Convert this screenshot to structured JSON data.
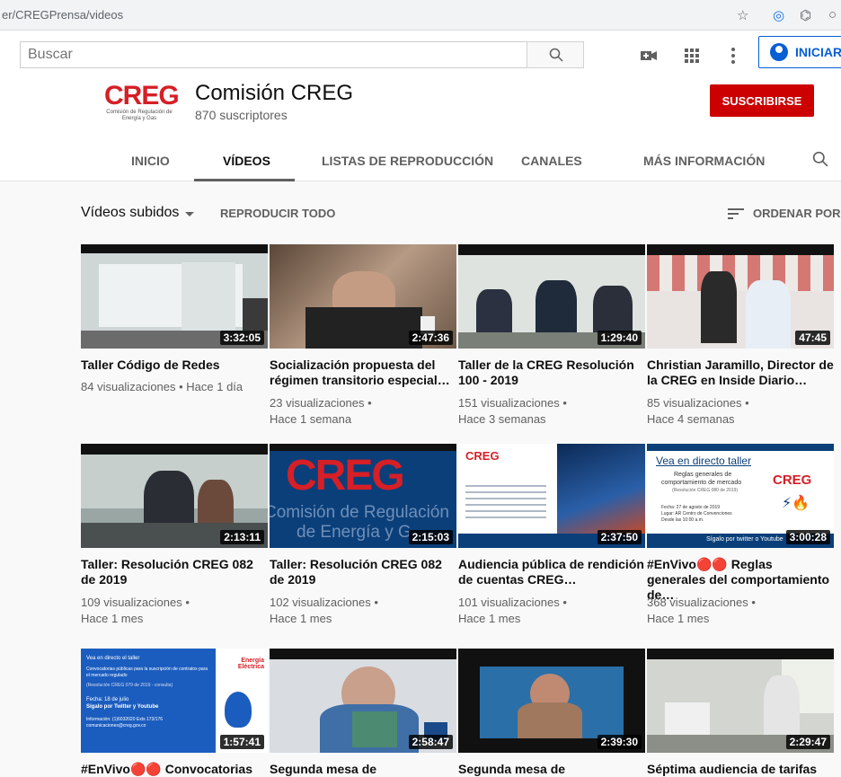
{
  "browser": {
    "url": "er/CREGPrensa/videos"
  },
  "header": {
    "search_placeholder": "Buscar",
    "signin_label": "INICIAR"
  },
  "channel": {
    "logo_text": "CREG",
    "logo_sub": "Comisión de Regulación de Energía y Gas",
    "name": "Comisión CREG",
    "subscribers": "870 suscriptores",
    "subscribe_label": "SUSCRIBIRSE"
  },
  "tabs": [
    "INICIO",
    "VÍDEOS",
    "LISTAS DE REPRODUCCIÓN",
    "CANALES",
    "MÁS INFORMACIÓN"
  ],
  "toolbar": {
    "section_title": "Vídeos subidos",
    "play_all": "REPRODUCIR TODO",
    "sort": "ORDENAR POR"
  },
  "videos": [
    {
      "title": "Taller Código de Redes",
      "views": "84 visualizaciones • Hace 1 día",
      "ago": "",
      "duration": "3:32:05"
    },
    {
      "title": "Socialización propuesta del régimen transitorio especial…",
      "views": "23 visualizaciones •",
      "ago": "Hace 1 semana",
      "duration": "2:47:36"
    },
    {
      "title": "Taller de la CREG Resolución 100 - 2019",
      "views": "151 visualizaciones •",
      "ago": "Hace 3 semanas",
      "duration": "1:29:40"
    },
    {
      "title": "Christian Jaramillo, Director de la CREG en Inside Diario…",
      "views": "85 visualizaciones •",
      "ago": "Hace 4 semanas",
      "duration": "47:45"
    },
    {
      "title": "Taller: Resolución CREG 082 de 2019",
      "views": "109 visualizaciones •",
      "ago": "Hace 1 mes",
      "duration": "2:13:11"
    },
    {
      "title": "Taller: Resolución CREG 082 de 2019",
      "views": "102 visualizaciones •",
      "ago": "Hace 1 mes",
      "duration": "2:15:03"
    },
    {
      "title": "Audiencia pública de rendición de cuentas CREG…",
      "views": "101 visualizaciones •",
      "ago": "Hace 1 mes",
      "duration": "2:37:50"
    },
    {
      "title": "#EnVivo🔴🔴 Reglas generales del comportamiento de…",
      "views": "368 visualizaciones •",
      "ago": "Hace 1 mes",
      "duration": "3:00:28"
    },
    {
      "title": "#EnVivo🔴🔴 Convocatorias",
      "views": "",
      "ago": "",
      "duration": "1:57:41"
    },
    {
      "title": "Segunda mesa de",
      "views": "",
      "ago": "",
      "duration": "2:58:47"
    },
    {
      "title": "Segunda mesa de",
      "views": "",
      "ago": "",
      "duration": "2:39:30"
    },
    {
      "title": "Séptima audiencia de tarifas",
      "views": "",
      "ago": "",
      "duration": "2:29:47"
    }
  ],
  "thumb_text": {
    "creg_big_1": "Comisión de Regulación",
    "creg_big_2": "de Energía y G",
    "live_title": "Vea en directo taller",
    "live_l1": "Reglas generales de",
    "live_l2": "comportamiento de mercado",
    "live_l3": "(Resolución CREG 080 de 2019)",
    "live_l4": "Fecha: 27 de agosto de 2019",
    "live_l5": "Lugar: AR Centro de Convenciones",
    "live_l6": "Desde las 10:00 a.m.",
    "live_foot": "Sígalo por twitter o Youtube",
    "conv_title": "Vea en directo el taller",
    "conv_l1": "Convocatorias públicas para la suscripción de contratos para el mercado regulado",
    "conv_l2": "(Resolución CREG 079 de 2019 - consulta)",
    "conv_l3": "Fecha: 18 de julio",
    "conv_l4": "Sígalo por Twitter y Youtube",
    "conv_l5": "Información: (1)6032020 Exts 173/176",
    "conv_l6": "comunicaciones@creg.gov.co",
    "conv_brand": "Energía Eléctrica"
  }
}
